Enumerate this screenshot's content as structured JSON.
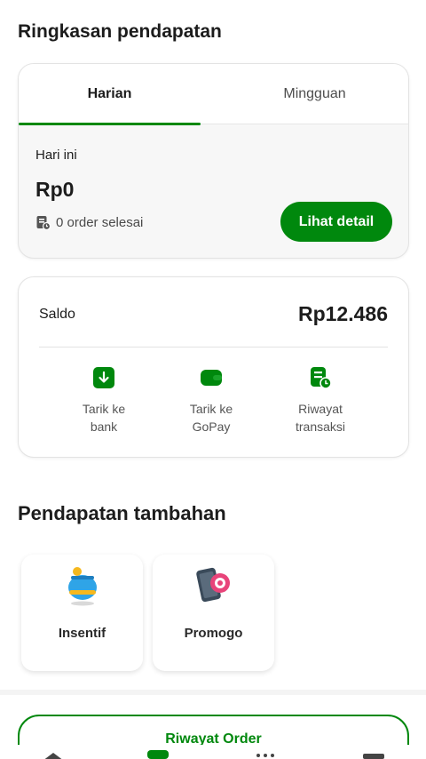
{
  "summary": {
    "title": "Ringkasan pendapatan",
    "tabs": [
      {
        "label": "Harian",
        "active": true
      },
      {
        "label": "Mingguan",
        "active": false
      }
    ],
    "today_label": "Hari ini",
    "today_value": "Rp0",
    "orders_text": "0 order selesai",
    "detail_button": "Lihat detail"
  },
  "balance": {
    "label": "Saldo",
    "value": "Rp12.486",
    "actions": [
      {
        "line1": "Tarik ke",
        "line2": "bank",
        "icon": "download-icon"
      },
      {
        "line1": "Tarik ke",
        "line2": "GoPay",
        "icon": "wallet-icon"
      },
      {
        "line1": "Riwayat",
        "line2": "transaksi",
        "icon": "history-icon"
      }
    ]
  },
  "extra": {
    "title": "Pendapatan tambahan",
    "items": [
      {
        "label": "Insentif",
        "icon": "piggy-bank-icon"
      },
      {
        "label": "Promogo",
        "icon": "phone-promo-icon"
      }
    ]
  },
  "history_button": "Riwayat Order",
  "colors": {
    "accent": "#00880d",
    "text": "#1c1c1c",
    "muted": "#555555",
    "promo_pink": "#e8447a",
    "piggy_blue": "#2fa4e7",
    "coin_yellow": "#f6b81e"
  }
}
